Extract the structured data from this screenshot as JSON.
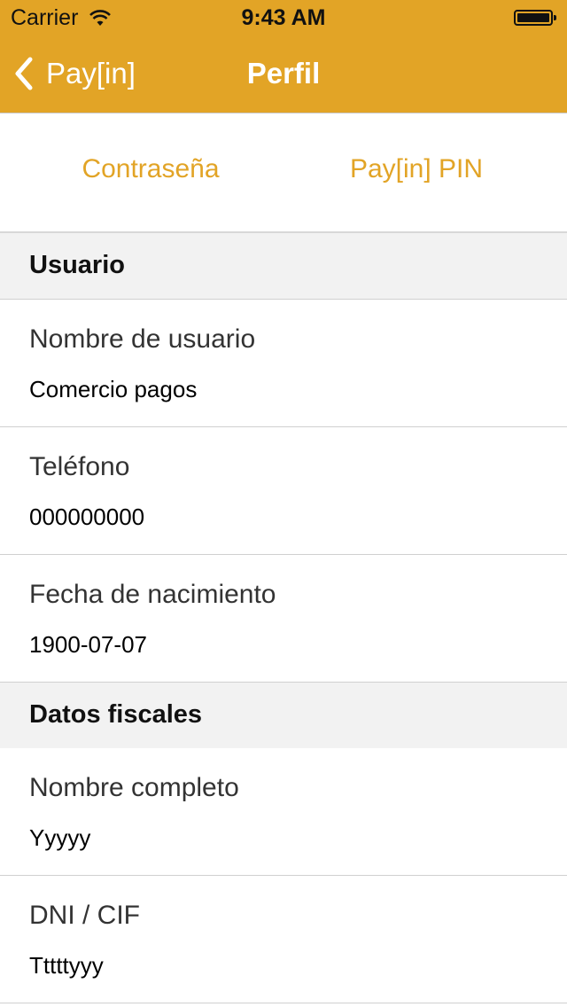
{
  "status_bar": {
    "carrier": "Carrier",
    "time": "9:43 AM"
  },
  "nav": {
    "back_label": "Pay[in]",
    "title": "Perfil"
  },
  "tabs": [
    {
      "label": "Contraseña"
    },
    {
      "label": "Pay[in] PIN"
    }
  ],
  "sections": [
    {
      "title": "Usuario",
      "rows": [
        {
          "label": "Nombre de usuario",
          "value": "Comercio pagos"
        },
        {
          "label": "Teléfono",
          "value": "000000000"
        },
        {
          "label": "Fecha de nacimiento",
          "value": "1900-07-07"
        }
      ]
    },
    {
      "title": "Datos fiscales",
      "rows": [
        {
          "label": "Nombre completo",
          "value": "Yyyyy"
        },
        {
          "label": "DNI / CIF",
          "value": "Tttttyyy"
        }
      ]
    }
  ],
  "colors": {
    "accent": "#e2a426",
    "section_bg": "#f2f2f2"
  }
}
